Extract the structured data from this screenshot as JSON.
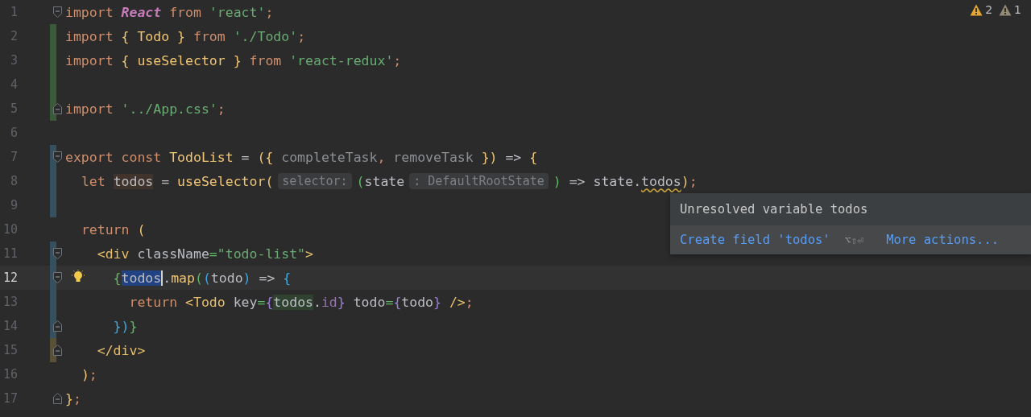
{
  "inspections": [
    {
      "kind": "warning",
      "count": "2"
    },
    {
      "kind": "weak",
      "count": "1"
    }
  ],
  "lines": [
    {
      "number": "1",
      "fold_start": true,
      "fold_end": false,
      "current": false,
      "bulb": false,
      "tokens": [
        {
          "text": "import ",
          "kind": "keyword"
        },
        {
          "text": "React",
          "kind": "type"
        },
        {
          "text": " from ",
          "kind": "keyword"
        },
        {
          "text": "'react'",
          "kind": "string"
        },
        {
          "text": ";",
          "kind": "punct"
        }
      ]
    },
    {
      "number": "2",
      "fold_start": false,
      "fold_end": false,
      "color": "#3a5a3a",
      "current": false,
      "bulb": false,
      "tokens": [
        {
          "text": "import ",
          "kind": "keyword"
        },
        {
          "text": "{ ",
          "kind": "brace-yellow"
        },
        {
          "text": "Todo",
          "kind": "function"
        },
        {
          "text": " }",
          "kind": "brace-yellow"
        },
        {
          "text": " from ",
          "kind": "keyword"
        },
        {
          "text": "'./Todo'",
          "kind": "string"
        },
        {
          "text": ";",
          "kind": "punct"
        }
      ]
    },
    {
      "number": "3",
      "fold_start": false,
      "fold_end": false,
      "color": "#3a5a3a",
      "current": false,
      "bulb": false,
      "tokens": [
        {
          "text": "import ",
          "kind": "keyword"
        },
        {
          "text": "{ ",
          "kind": "brace-yellow"
        },
        {
          "text": "useSelector",
          "kind": "function"
        },
        {
          "text": " }",
          "kind": "brace-yellow"
        },
        {
          "text": " from ",
          "kind": "keyword"
        },
        {
          "text": "'react-redux'",
          "kind": "string"
        },
        {
          "text": ";",
          "kind": "punct"
        }
      ]
    },
    {
      "number": "4",
      "fold_start": false,
      "fold_end": false,
      "color": "#3a5a3a",
      "current": false,
      "bulb": false
    },
    {
      "number": "5",
      "fold_start": false,
      "fold_end": true,
      "color": "#3a5a3a",
      "current": false,
      "bulb": false,
      "tokens": [
        {
          "text": "import ",
          "kind": "keyword"
        },
        {
          "text": "'../App.css'",
          "kind": "string"
        },
        {
          "text": ";",
          "kind": "punct"
        }
      ]
    },
    {
      "number": "6",
      "fold_start": false,
      "fold_end": false,
      "current": false,
      "bulb": false
    },
    {
      "number": "7",
      "fold_start": true,
      "fold_end": false,
      "color": "#35505f",
      "current": false,
      "bulb": false,
      "tokens": [
        {
          "text": "export const ",
          "kind": "keyword"
        },
        {
          "text": "TodoList",
          "kind": "function"
        },
        {
          "text": " = ",
          "kind": "plain"
        },
        {
          "text": "({",
          "kind": "brace-yellow"
        },
        {
          "text": " completeTask",
          "kind": "param"
        },
        {
          "text": ",",
          "kind": "punct"
        },
        {
          "text": " removeTask",
          "kind": "param"
        },
        {
          "text": " })",
          "kind": "brace-yellow"
        },
        {
          "text": " => ",
          "kind": "plain"
        },
        {
          "text": "{",
          "kind": "brace-yellow"
        }
      ]
    },
    {
      "number": "8",
      "fold_start": false,
      "fold_end": false,
      "color": "#35505f",
      "current": false,
      "bulb": false,
      "tokens": [
        {
          "text": "  let ",
          "kind": "keyword"
        },
        {
          "text": "todos",
          "kind": "write"
        },
        {
          "text": " = ",
          "kind": "plain"
        },
        {
          "text": "useSelector",
          "kind": "function"
        },
        {
          "text": "(",
          "kind": "brace-yellow"
        },
        {
          "text": "selector:",
          "kind": "hint"
        },
        {
          "text": "(",
          "kind": "brace-green"
        },
        {
          "text": "state",
          "kind": "plain"
        },
        {
          "text": ": DefaultRootState",
          "kind": "hint"
        },
        {
          "text": ")",
          "kind": "brace-green"
        },
        {
          "text": " => state.",
          "kind": "plain"
        },
        {
          "text": "todos",
          "kind": "warning"
        },
        {
          "text": ")",
          "kind": "brace-yellow"
        },
        {
          "text": ";",
          "kind": "punct"
        }
      ]
    },
    {
      "number": "9",
      "fold_start": false,
      "fold_end": false,
      "color": "#35505f",
      "current": false,
      "bulb": false
    },
    {
      "number": "10",
      "fold_start": false,
      "fold_end": false,
      "current": false,
      "bulb": false,
      "tokens": [
        {
          "text": "  return ",
          "kind": "keyword"
        },
        {
          "text": "(",
          "kind": "brace-yellow"
        }
      ]
    },
    {
      "number": "11",
      "fold_start": true,
      "fold_end": false,
      "color": "#35505f",
      "current": false,
      "bulb": false,
      "tokens": [
        {
          "text": "    <div",
          "kind": "tag"
        },
        {
          "text": " className",
          "kind": "plain"
        },
        {
          "text": "=",
          "kind": "brace-green"
        },
        {
          "text": "\"todo-list\"",
          "kind": "string"
        },
        {
          "text": ">",
          "kind": "tag"
        }
      ]
    },
    {
      "number": "12",
      "fold_start": true,
      "fold_end": false,
      "color": "#35505f",
      "current": true,
      "bulb": true,
      "tokens": [
        {
          "text": "      {",
          "kind": "brace-green"
        },
        {
          "text": "todos",
          "kind": "selection"
        },
        {
          "text": ".",
          "kind": "plain"
        },
        {
          "text": "map",
          "kind": "function"
        },
        {
          "text": "(",
          "kind": "brace-green"
        },
        {
          "text": "(",
          "kind": "brace-blue"
        },
        {
          "text": "todo",
          "kind": "plain"
        },
        {
          "text": ")",
          "kind": "brace-blue"
        },
        {
          "text": " => ",
          "kind": "plain"
        },
        {
          "text": "{",
          "kind": "brace-blue"
        }
      ]
    },
    {
      "number": "13",
      "fold_start": false,
      "fold_end": false,
      "color": "#35505f",
      "current": false,
      "bulb": false,
      "tokens": [
        {
          "text": "        return ",
          "kind": "keyword"
        },
        {
          "text": "<Todo",
          "kind": "tag"
        },
        {
          "text": " key",
          "kind": "plain"
        },
        {
          "text": "=",
          "kind": "brace-green"
        },
        {
          "text": "{",
          "kind": "brace-purple"
        },
        {
          "text": "todos",
          "kind": "read"
        },
        {
          "text": ".",
          "kind": "plain"
        },
        {
          "text": "id",
          "kind": "property"
        },
        {
          "text": "}",
          "kind": "brace-purple"
        },
        {
          "text": " todo",
          "kind": "plain"
        },
        {
          "text": "=",
          "kind": "brace-green"
        },
        {
          "text": "{",
          "kind": "brace-purple"
        },
        {
          "text": "todo",
          "kind": "plain"
        },
        {
          "text": "}",
          "kind": "brace-purple"
        },
        {
          "text": " />",
          "kind": "tag"
        },
        {
          "text": ";",
          "kind": "punct"
        }
      ]
    },
    {
      "number": "14",
      "fold_start": false,
      "fold_end": true,
      "color": "#35505f",
      "current": false,
      "bulb": false,
      "tokens": [
        {
          "text": "      })",
          "kind": "brace-blue"
        },
        {
          "text": "}",
          "kind": "brace-green"
        }
      ]
    },
    {
      "number": "15",
      "fold_start": false,
      "fold_end": true,
      "color": "#5a5035",
      "current": false,
      "bulb": false,
      "tokens": [
        {
          "text": "    </div>",
          "kind": "tag"
        }
      ]
    },
    {
      "number": "16",
      "fold_start": false,
      "fold_end": false,
      "current": false,
      "bulb": false,
      "tokens": [
        {
          "text": "  )",
          "kind": "brace-yellow"
        },
        {
          "text": ";",
          "kind": "punct"
        }
      ]
    },
    {
      "number": "17",
      "fold_start": false,
      "fold_end": true,
      "current": false,
      "bulb": false,
      "tokens": [
        {
          "text": "}",
          "kind": "brace-yellow"
        },
        {
          "text": ";",
          "kind": "punct"
        }
      ]
    }
  ],
  "popup": {
    "message": "Unresolved variable todos",
    "action": {
      "label": "Create field 'todos'",
      "shortcut": "⌥⇧⏎"
    },
    "more": "More actions..."
  }
}
